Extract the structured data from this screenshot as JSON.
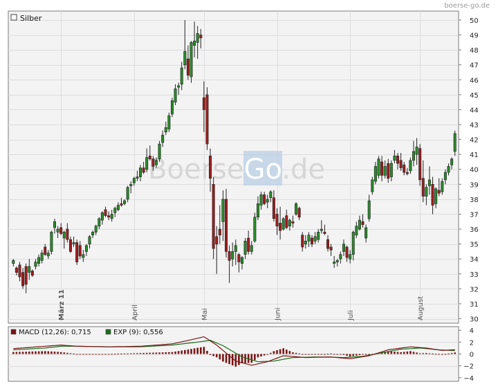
{
  "watermark": "boerse-go.de",
  "center_logo": {
    "part1": "Boerse",
    "part2": "Go",
    "part3": ".de"
  },
  "chart_data": [
    {
      "type": "candlestick",
      "title": "Silber",
      "ylim": [
        29.7,
        50.6
      ],
      "y_ticks": [
        30,
        31,
        32,
        33,
        34,
        35,
        36,
        37,
        38,
        39,
        40,
        41,
        42,
        43,
        44,
        45,
        46,
        47,
        48,
        49,
        50
      ],
      "x_tick_labels": [
        {
          "label": "März 11",
          "index": 15
        },
        {
          "label": "April",
          "index": 38
        },
        {
          "label": "Mai",
          "index": 60
        },
        {
          "label": "Juni",
          "index": 83
        },
        {
          "label": "Juli",
          "index": 106
        },
        {
          "label": "August",
          "index": 128
        }
      ],
      "colors": {
        "up": "#1a6e1a",
        "down": "#8b1a1a"
      },
      "candles": [
        [
          0,
          33.7,
          34.0,
          33.5,
          33.9
        ],
        [
          1,
          33.4,
          33.5,
          32.9,
          33.1
        ],
        [
          2,
          33.6,
          33.8,
          32.5,
          32.8
        ],
        [
          3,
          33.1,
          33.4,
          32.0,
          32.2
        ],
        [
          4,
          33.5,
          33.7,
          31.7,
          32.3
        ],
        [
          5,
          33.1,
          34.0,
          32.6,
          33.5
        ],
        [
          6,
          33.2,
          33.3,
          32.8,
          32.9
        ],
        [
          7,
          33.5,
          34.0,
          33.3,
          33.8
        ],
        [
          8,
          33.7,
          34.3,
          33.5,
          34.1
        ],
        [
          9,
          33.9,
          34.6,
          33.7,
          34.4
        ],
        [
          10,
          34.8,
          35.0,
          34.2,
          34.3
        ],
        [
          11,
          34.2,
          34.6,
          34.0,
          34.4
        ],
        [
          12,
          34.5,
          35.9,
          34.3,
          35.8
        ],
        [
          13,
          36.1,
          36.7,
          35.7,
          36.5
        ],
        [
          14,
          35.8,
          36.2,
          35.4,
          36.0
        ],
        [
          15,
          36.1,
          36.4,
          35.6,
          35.7
        ],
        [
          16,
          35.4,
          35.9,
          34.7,
          35.8
        ],
        [
          17,
          36.0,
          36.4,
          35.1,
          35.3
        ],
        [
          18,
          35.3,
          35.5,
          34.4,
          34.5
        ],
        [
          19,
          35.0,
          35.5,
          34.8,
          35.1
        ],
        [
          20,
          35.1,
          35.3,
          33.6,
          33.8
        ],
        [
          21,
          34.9,
          35.2,
          34.0,
          34.2
        ],
        [
          22,
          34.1,
          34.6,
          33.8,
          34.3
        ],
        [
          23,
          34.5,
          35.0,
          34.2,
          34.9
        ],
        [
          24,
          35.0,
          35.6,
          34.7,
          35.5
        ],
        [
          25,
          35.6,
          35.9,
          35.4,
          35.8
        ],
        [
          26,
          35.8,
          36.3,
          35.6,
          36.2
        ],
        [
          27,
          36.2,
          36.8,
          36.0,
          36.7
        ],
        [
          28,
          36.6,
          37.2,
          36.3,
          37.1
        ],
        [
          29,
          37.3,
          37.5,
          36.8,
          36.9
        ],
        [
          30,
          36.9,
          37.2,
          36.6,
          36.8
        ],
        [
          31,
          36.7,
          37.3,
          36.5,
          37.0
        ],
        [
          32,
          37.1,
          37.5,
          36.8,
          37.4
        ],
        [
          33,
          37.3,
          37.8,
          37.2,
          37.6
        ],
        [
          34,
          37.7,
          38.1,
          37.5,
          37.6
        ],
        [
          35,
          37.7,
          38.0,
          37.6,
          37.9
        ],
        [
          36,
          38.0,
          38.9,
          37.8,
          38.8
        ],
        [
          37,
          38.9,
          39.2,
          38.4,
          39.0
        ],
        [
          38,
          39.1,
          39.5,
          38.9,
          39.4
        ],
        [
          39,
          39.4,
          39.9,
          39.2,
          39.5
        ],
        [
          40,
          39.5,
          40.3,
          39.2,
          40.1
        ],
        [
          41,
          40.1,
          40.5,
          39.7,
          39.8
        ],
        [
          42,
          40.0,
          41.4,
          39.8,
          40.8
        ],
        [
          43,
          40.9,
          41.6,
          40.6,
          40.7
        ],
        [
          44,
          40.7,
          40.9,
          39.9,
          40.2
        ],
        [
          45,
          40.3,
          40.8,
          40.1,
          40.6
        ],
        [
          46,
          40.7,
          41.9,
          40.5,
          41.7
        ],
        [
          47,
          41.8,
          42.6,
          41.5,
          42.3
        ],
        [
          48,
          42.5,
          43.2,
          42.3,
          42.8
        ],
        [
          49,
          42.7,
          43.8,
          42.5,
          43.6
        ],
        [
          50,
          43.7,
          44.8,
          43.5,
          44.6
        ],
        [
          51,
          44.5,
          45.7,
          44.3,
          45.4
        ],
        [
          52,
          45.5,
          45.8,
          45.0,
          45.6
        ],
        [
          53,
          45.7,
          47.2,
          45.3,
          46.8
        ],
        [
          54,
          47.0,
          50.0,
          46.7,
          47.9
        ],
        [
          55,
          47.4,
          48.3,
          46.0,
          46.3
        ],
        [
          56,
          46.2,
          48.6,
          45.8,
          48.5
        ],
        [
          57,
          48.3,
          49.9,
          47.5,
          48.6
        ],
        [
          58,
          48.5,
          49.6,
          47.4,
          49.1
        ],
        [
          59,
          49.0,
          49.4,
          48.1,
          48.8
        ],
        [
          60,
          44.8,
          45.9,
          42.5,
          44.0
        ],
        [
          61,
          45.0,
          45.5,
          41.3,
          41.7
        ],
        [
          62,
          40.9,
          41.4,
          38.5,
          39.4
        ],
        [
          63,
          39.0,
          39.5,
          34.0,
          34.7
        ],
        [
          64,
          35.5,
          36.2,
          33.0,
          35.0
        ],
        [
          65,
          36.0,
          37.6,
          35.0,
          35.6
        ],
        [
          66,
          36.5,
          38.6,
          35.2,
          38.0
        ],
        [
          67,
          38.0,
          38.7,
          34.1,
          34.5
        ],
        [
          68,
          34.5,
          34.9,
          32.4,
          33.9
        ],
        [
          69,
          34.0,
          35.1,
          33.5,
          34.5
        ],
        [
          70,
          34.5,
          35.3,
          33.6,
          34.9
        ],
        [
          71,
          34.3,
          34.4,
          33.1,
          33.8
        ],
        [
          72,
          33.7,
          34.2,
          33.3,
          34.1
        ],
        [
          73,
          34.3,
          35.4,
          34.0,
          35.2
        ],
        [
          74,
          35.4,
          35.9,
          34.3,
          34.5
        ],
        [
          75,
          34.5,
          35.2,
          34.3,
          34.9
        ],
        [
          76,
          35.2,
          37.1,
          35.1,
          36.8
        ],
        [
          77,
          36.8,
          38.2,
          36.6,
          37.7
        ],
        [
          78,
          37.6,
          38.5,
          37.3,
          38.3
        ],
        [
          79,
          38.3,
          38.5,
          37.6,
          37.7
        ],
        [
          80,
          37.8,
          38.3,
          37.4,
          38.0
        ],
        [
          81,
          38.1,
          38.6,
          37.8,
          38.5
        ],
        [
          82,
          38.1,
          38.6,
          36.5,
          36.7
        ],
        [
          83,
          37.0,
          37.4,
          35.6,
          36.2
        ],
        [
          84,
          36.4,
          37.5,
          35.3,
          35.9
        ],
        [
          85,
          36.0,
          36.8,
          35.9,
          36.7
        ],
        [
          86,
          36.9,
          37.3,
          36.0,
          36.1
        ],
        [
          87,
          36.2,
          36.7,
          35.9,
          36.6
        ],
        [
          88,
          36.5,
          36.9,
          36.1,
          36.4
        ],
        [
          89,
          37.0,
          37.8,
          36.9,
          37.7
        ],
        [
          90,
          37.4,
          37.5,
          36.6,
          36.8
        ],
        [
          91,
          35.6,
          35.8,
          34.5,
          34.8
        ],
        [
          92,
          35.0,
          35.6,
          34.7,
          35.2
        ],
        [
          93,
          35.2,
          35.8,
          34.8,
          35.6
        ],
        [
          94,
          35.4,
          35.6,
          34.8,
          35.0
        ],
        [
          95,
          35.2,
          35.8,
          35.0,
          35.5
        ],
        [
          96,
          35.3,
          36.0,
          35.1,
          35.8
        ],
        [
          97,
          35.9,
          36.6,
          35.7,
          36.0
        ],
        [
          98,
          35.8,
          36.3,
          35.6,
          35.7
        ],
        [
          99,
          35.3,
          35.6,
          34.5,
          34.7
        ],
        [
          100,
          34.8,
          35.0,
          34.2,
          34.6
        ],
        [
          101,
          33.7,
          34.2,
          33.4,
          33.8
        ],
        [
          102,
          33.8,
          34.0,
          33.5,
          33.9
        ],
        [
          103,
          34.0,
          34.5,
          33.7,
          34.3
        ],
        [
          104,
          34.5,
          35.3,
          34.2,
          35.0
        ],
        [
          105,
          34.8,
          34.9,
          33.8,
          34.1
        ],
        [
          106,
          34.0,
          34.6,
          33.7,
          34.3
        ],
        [
          107,
          34.3,
          35.9,
          33.9,
          35.8
        ],
        [
          108,
          35.6,
          36.5,
          35.4,
          36.2
        ],
        [
          109,
          36.0,
          36.9,
          35.9,
          36.6
        ],
        [
          110,
          36.5,
          37.0,
          36.1,
          36.3
        ],
        [
          111,
          35.4,
          36.3,
          35.1,
          36.1
        ],
        [
          112,
          36.7,
          38.3,
          36.5,
          37.9
        ],
        [
          113,
          38.5,
          39.5,
          38.3,
          39.3
        ],
        [
          114,
          39.2,
          40.5,
          39.0,
          40.2
        ],
        [
          115,
          39.6,
          40.9,
          39.4,
          40.7
        ],
        [
          116,
          40.5,
          40.9,
          39.2,
          39.6
        ],
        [
          117,
          39.6,
          40.6,
          39.4,
          40.2
        ],
        [
          118,
          40.4,
          40.7,
          39.1,
          39.4
        ],
        [
          119,
          39.5,
          40.6,
          39.2,
          40.4
        ],
        [
          120,
          40.6,
          41.3,
          40.4,
          40.9
        ],
        [
          121,
          40.9,
          41.1,
          40.0,
          40.4
        ],
        [
          122,
          40.6,
          41.1,
          39.9,
          40.1
        ],
        [
          123,
          40.3,
          40.5,
          39.6,
          39.8
        ],
        [
          124,
          39.8,
          40.1,
          39.6,
          39.7
        ],
        [
          125,
          39.9,
          40.8,
          39.7,
          40.6
        ],
        [
          126,
          40.6,
          41.9,
          40.2,
          41.2
        ],
        [
          127,
          41.0,
          42.1,
          40.3,
          41.5
        ],
        [
          128,
          41.4,
          41.7,
          38.9,
          39.3
        ],
        [
          129,
          39.4,
          40.6,
          37.8,
          38.2
        ],
        [
          130,
          38.2,
          39.0,
          37.6,
          38.8
        ],
        [
          131,
          38.9,
          40.2,
          38.3,
          39.3
        ],
        [
          132,
          39.0,
          39.5,
          37.0,
          37.6
        ],
        [
          133,
          37.7,
          38.8,
          37.4,
          38.7
        ],
        [
          134,
          38.6,
          39.4,
          38.2,
          38.4
        ],
        [
          135,
          38.5,
          39.4,
          38.3,
          39.2
        ],
        [
          136,
          39.3,
          40.0,
          39.0,
          39.8
        ],
        [
          137,
          39.8,
          40.4,
          39.6,
          40.2
        ],
        [
          138,
          40.3,
          40.8,
          40.0,
          40.7
        ],
        [
          139,
          41.2,
          42.6,
          40.9,
          42.4
        ]
      ]
    },
    {
      "type": "macd",
      "ylim": [
        -4.6,
        4.6
      ],
      "y_ticks": [
        4,
        2,
        0,
        -2,
        -4
      ],
      "legend": [
        {
          "label": "MACD (12,26): 0,715",
          "color": "#7a1414"
        },
        {
          "label": "EXP (9): 0,556",
          "color": "#1a6e1a"
        }
      ],
      "macd_anchors": [
        [
          0,
          0.9
        ],
        [
          10,
          1.3
        ],
        [
          15,
          1.5
        ],
        [
          20,
          1.3
        ],
        [
          30,
          1.2
        ],
        [
          40,
          1.3
        ],
        [
          50,
          1.7
        ],
        [
          56,
          2.4
        ],
        [
          60,
          2.9
        ],
        [
          64,
          1.5
        ],
        [
          70,
          -1.2
        ],
        [
          75,
          -1.9
        ],
        [
          80,
          -1.3
        ],
        [
          85,
          -0.3
        ],
        [
          92,
          -0.6
        ],
        [
          100,
          -0.5
        ],
        [
          106,
          -0.8
        ],
        [
          112,
          -0.3
        ],
        [
          118,
          0.7
        ],
        [
          125,
          1.2
        ],
        [
          130,
          1.0
        ],
        [
          135,
          0.6
        ],
        [
          139,
          0.715
        ]
      ],
      "signal_anchors": [
        [
          0,
          0.7
        ],
        [
          10,
          1.0
        ],
        [
          15,
          1.3
        ],
        [
          20,
          1.3
        ],
        [
          30,
          1.2
        ],
        [
          40,
          1.2
        ],
        [
          50,
          1.5
        ],
        [
          58,
          2.0
        ],
        [
          62,
          2.3
        ],
        [
          66,
          1.4
        ],
        [
          72,
          -0.5
        ],
        [
          77,
          -1.3
        ],
        [
          82,
          -1.2
        ],
        [
          88,
          -0.6
        ],
        [
          96,
          -0.5
        ],
        [
          104,
          -0.6
        ],
        [
          110,
          -0.4
        ],
        [
          116,
          0.2
        ],
        [
          122,
          0.8
        ],
        [
          128,
          1.0
        ],
        [
          134,
          0.7
        ],
        [
          139,
          0.556
        ]
      ]
    }
  ]
}
